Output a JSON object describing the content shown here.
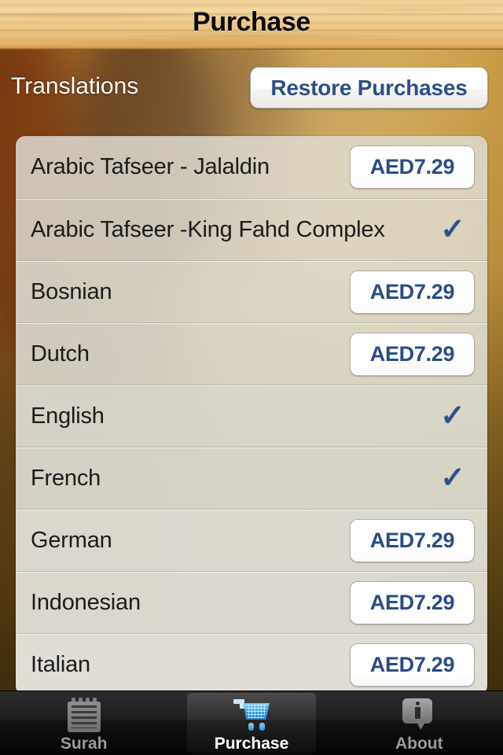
{
  "navbar": {
    "title": "Purchase"
  },
  "section": {
    "title": "Translations",
    "restore_label": "Restore Purchases"
  },
  "colors": {
    "price_text": "#2b4c84",
    "check_mark": "#2f5288",
    "restore_text": "#2e4f87",
    "row_background": "#dfddd2",
    "navbar_wood": "#eeca8b",
    "tabbar_background": "#141414",
    "tab_selected_text": "#ffffff",
    "tab_text": "#9b9b9b"
  },
  "price_button_label": "AED7.29",
  "purchased_glyph": "✓",
  "translations": [
    {
      "name": "Arabic Tafseer - Jalaldin",
      "purchased": false,
      "price": "AED7.29"
    },
    {
      "name": "Arabic Tafseer -King Fahd Complex",
      "purchased": true,
      "price": ""
    },
    {
      "name": "Bosnian",
      "purchased": false,
      "price": "AED7.29"
    },
    {
      "name": "Dutch",
      "purchased": false,
      "price": "AED7.29"
    },
    {
      "name": "English",
      "purchased": true,
      "price": ""
    },
    {
      "name": "French",
      "purchased": true,
      "price": ""
    },
    {
      "name": "German",
      "purchased": false,
      "price": "AED7.29"
    },
    {
      "name": "Indonesian",
      "purchased": false,
      "price": "AED7.29"
    },
    {
      "name": "Italian",
      "purchased": false,
      "price": "AED7.29"
    }
  ],
  "tabbar": {
    "items": [
      {
        "label": "Surah",
        "icon": "notepad-icon",
        "selected": false
      },
      {
        "label": "Purchase",
        "icon": "cart-icon",
        "selected": true
      },
      {
        "label": "About",
        "icon": "info-icon",
        "selected": false
      }
    ]
  }
}
